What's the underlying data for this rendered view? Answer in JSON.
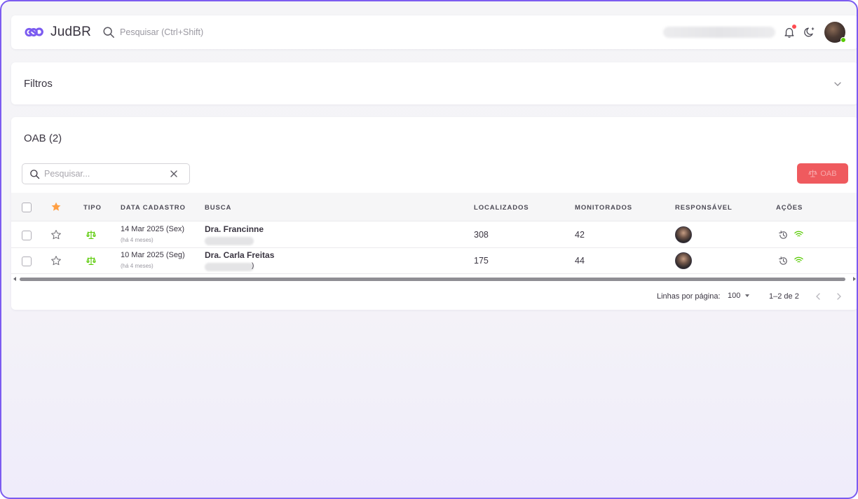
{
  "app": {
    "name": "JudBR",
    "search_placeholder": "Pesquisar (Ctrl+Shift)",
    "brand_color": "#7c5cf0"
  },
  "filters": {
    "title": "Filtros"
  },
  "oab": {
    "title": "OAB (2)",
    "search_placeholder": "Pesquisar...",
    "add_button_label": "OAB",
    "add_button_color": "#ef5a5e",
    "columns": {
      "tipo": "TIPO",
      "data_cadastro": "DATA CADASTRO",
      "busca": "BUSCA",
      "localizados": "LOCALIZADOS",
      "monitorados": "MONITORADOS",
      "responsavel": "RESPONSÁVEL",
      "acoes": "AÇÕES"
    },
    "rows": [
      {
        "date": "14 Mar 2025 (Sex)",
        "relative": "(há 4 meses)",
        "name": "Dra. Francinne",
        "localizados": "308",
        "monitorados": "42"
      },
      {
        "date": "10 Mar 2025 (Seg)",
        "relative": "(há 4 meses)",
        "name": "Dra. Carla Freitas",
        "localizados": "175",
        "monitorados": "44"
      }
    ]
  },
  "pagination": {
    "rows_per_page_label": "Linhas por página:",
    "rows_per_page_value": "100",
    "range": "1–2 de 2"
  },
  "icons": {
    "status_green": "#56ca00",
    "star_active": "#ff9f43",
    "notification_dot": "#ff4c51"
  }
}
